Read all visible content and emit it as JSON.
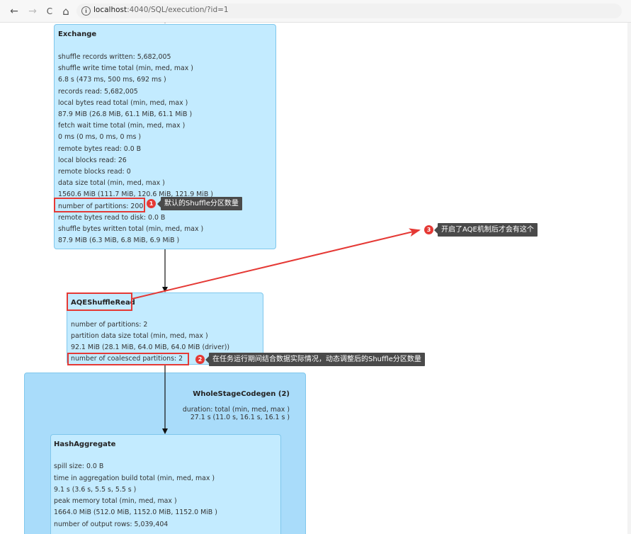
{
  "browser": {
    "back": "←",
    "forward": "→",
    "reload": "C",
    "home": "⌂",
    "info": "i",
    "url_host": "localhost",
    "url_rest": ":4040/SQL/execution/?id=1"
  },
  "exchange": {
    "title": "Exchange",
    "metrics": [
      "shuffle records written: 5,682,005",
      "shuffle write time total (min, med, max )",
      "6.8 s (473 ms, 500 ms, 692 ms )",
      "records read: 5,682,005",
      "local bytes read total (min, med, max )",
      "87.9 MiB (26.8 MiB, 61.1 MiB, 61.1 MiB )",
      "fetch wait time total (min, med, max )",
      "0 ms (0 ms, 0 ms, 0 ms )",
      "remote bytes read: 0.0 B",
      "local blocks read: 26",
      "remote blocks read: 0",
      "data size total (min, med, max )",
      "1560.6 MiB (111.7 MiB, 120.6 MiB, 121.9 MiB )",
      "number of partitions: 200",
      "remote bytes read to disk: 0.0 B",
      "shuffle bytes written total (min, med, max )",
      "87.9 MiB (6.3 MiB, 6.8 MiB, 6.9 MiB )"
    ]
  },
  "aqe": {
    "title": "AQEShuffleRead",
    "metrics": [
      "number of partitions: 2",
      "partition data size total (min, med, max )",
      "92.1 MiB (28.1 MiB, 64.0 MiB, 64.0 MiB (driver))",
      "number of coalesced partitions: 2"
    ]
  },
  "wholestage": {
    "title": "WholeStageCodegen (2)",
    "duration_label": "duration: total (min, med, max )",
    "duration_value": "27.1 s (11.0 s, 16.1 s, 16.1 s )"
  },
  "hashagg": {
    "title": "HashAggregate",
    "metrics": [
      "spill size: 0.0 B",
      "time in aggregation build total (min, med, max )",
      "9.1 s (3.6 s, 5.5 s, 5.5 s )",
      "peak memory total (min, med, max )",
      "1664.0 MiB (512.0 MiB, 1152.0 MiB, 1152.0 MiB )",
      "number of output rows: 5,039,404"
    ]
  },
  "annotations": [
    {
      "num": "1",
      "text": "默认的Shuffle分区数量"
    },
    {
      "num": "2",
      "text": "在任务运行期间结合数据实际情况，动态调整后的Shuffle分区数量"
    },
    {
      "num": "3",
      "text": "开启了AQE机制后才会有这个"
    }
  ],
  "colors": {
    "node": "#c3ebff",
    "cluster": "#a9dcfa",
    "highlight": "#e53935",
    "tooltip": "#4a4a4a"
  }
}
